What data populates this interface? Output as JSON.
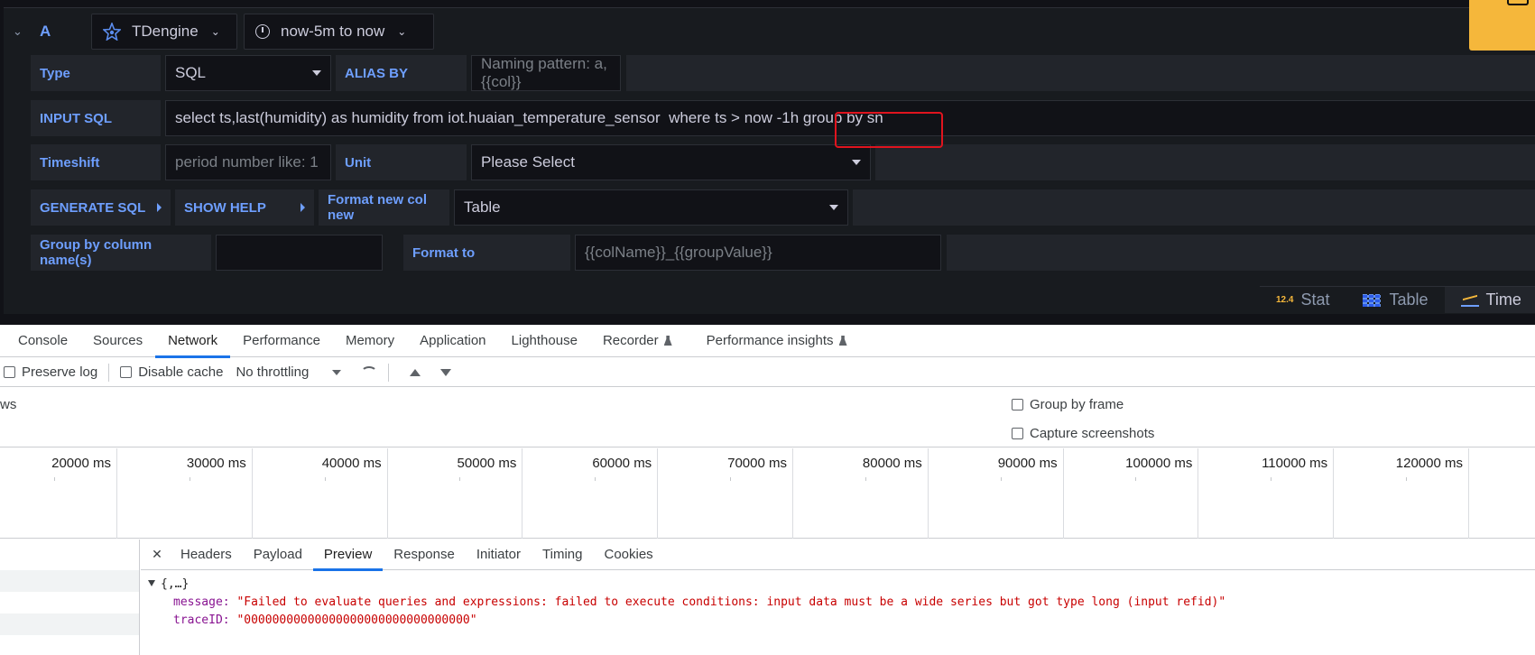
{
  "grafana": {
    "ref_id": "A",
    "datasource": "TDengine",
    "time_range": "now-5m to now",
    "rows": {
      "type_label": "Type",
      "type_value": "SQL",
      "alias_label": "ALIAS BY",
      "alias_placeholder": "Naming pattern: a,{{col}}",
      "input_sql_label": "INPUT SQL",
      "input_sql_value": "select ts,last(humidity) as humidity from iot.huaian_temperature_sensor  where ts > now -1h group by sn",
      "timeshift_label": "Timeshift",
      "timeshift_placeholder": "period number like: 1",
      "unit_label": "Unit",
      "unit_value": "Please Select",
      "generate_sql_label": "GENERATE SQL",
      "show_help_label": "SHOW HELP",
      "format_new_col_label": "Format new col new",
      "format_new_col_value": "Table",
      "group_by_label": "Group by column name(s)",
      "group_by_value": "",
      "format_to_label": "Format to",
      "format_to_placeholder": "{{colName}}_{{groupValue}}"
    },
    "viz_tabs": [
      {
        "icon": "12.4",
        "label": "Stat"
      },
      {
        "icon": "table-icon",
        "label": "Table"
      },
      {
        "icon": "time-series-icon",
        "label": "Time"
      }
    ]
  },
  "devtools": {
    "tabs": [
      "Console",
      "Sources",
      "Network",
      "Performance",
      "Memory",
      "Application",
      "Lighthouse",
      "Recorder",
      "Performance insights"
    ],
    "active_tab": "Network",
    "toolbar": {
      "preserve_log": "Preserve log",
      "disable_cache": "Disable cache",
      "throttling": "No throttling"
    },
    "options": {
      "ws_fragment": "ws",
      "group_by_frame": "Group by frame",
      "capture_screenshots": "Capture screenshots"
    },
    "timeline_ticks": [
      "20000 ms",
      "30000 ms",
      "40000 ms",
      "50000 ms",
      "60000 ms",
      "70000 ms",
      "80000 ms",
      "90000 ms",
      "100000 ms",
      "110000 ms",
      "120000 ms"
    ],
    "detail_tabs": [
      "Headers",
      "Payload",
      "Preview",
      "Response",
      "Initiator",
      "Timing",
      "Cookies"
    ],
    "active_detail_tab": "Preview",
    "preview": {
      "root": "{,…}",
      "message_key": "message:",
      "message_value": "\"Failed to evaluate queries and expressions: failed to execute conditions: input data must be a wide series but got type long (input refid)\"",
      "trace_key": "traceID:",
      "trace_value": "\"00000000000000000000000000000000\""
    }
  },
  "colors": {
    "grafana_bg": "#181b1f",
    "grafana_label": "#6e9fff",
    "highlight_box": "#e0141e",
    "devtools_active": "#1a73e8",
    "error_string": "#c80000"
  }
}
